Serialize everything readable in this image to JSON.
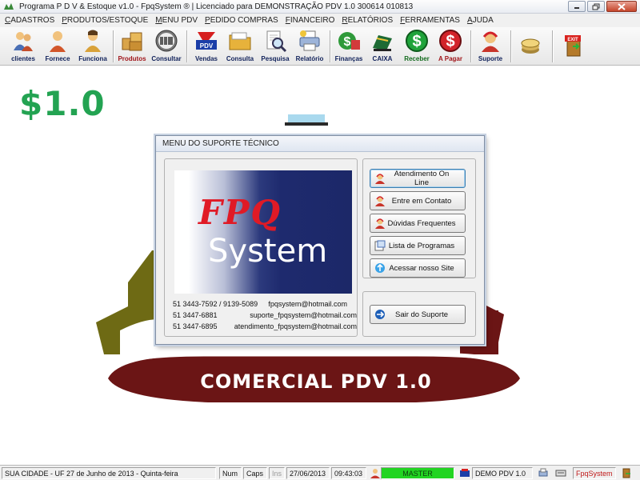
{
  "window": {
    "title": "Programa P D V & Estoque v1.0 - FpqSystem ® | Licenciado para  DEMONSTRAÇÃO PDV 1.0 300614 010813"
  },
  "menu": [
    "CADASTROS",
    "PRODUTOS/ESTOQUE",
    "MENU PDV",
    "PEDIDO COMPRAS",
    "FINANCEIRO",
    "RELATÓRIOS",
    "FERRAMENTAS",
    "AJUDA"
  ],
  "toolbar": {
    "clientes": "clientes",
    "fornece": "Fornece",
    "funciona": "Funciona",
    "produtos": "Produtos",
    "consultar": "Consultar",
    "vendas": "Vendas",
    "consulta": "Consulta",
    "pesquisa": "Pesquisa",
    "relatorio": "Relatório",
    "financas": "Finanças",
    "caixa": "CAIXA",
    "receber": "Receber",
    "apagar": "A Pagar",
    "suporte": "Suporte",
    "pdv_badge": "PDV",
    "exit_badge": "EXIT"
  },
  "desktop": {
    "version": "$1.0",
    "caption": "COMERCIAL PDV 1.0"
  },
  "dialog": {
    "title": "MENU DO SUPORTE TÉCNICO",
    "banner_brand": "FPQ",
    "banner_system": "System",
    "contacts": [
      {
        "phone": "51 3443-7592 / 9139-5089",
        "email": "fpqsystem@hotmail.com"
      },
      {
        "phone": "51 3447-6881",
        "email": "suporte_fpqsystem@hotmail.com"
      },
      {
        "phone": "51 3447-6895",
        "email": "atendimento_fpqsystem@hotmail.com"
      }
    ],
    "buttons": {
      "online": "Atendimento On Line",
      "contato": "Entre em Contato",
      "duvidas": "Dúvidas Frequentes",
      "programas": "Lista de Programas",
      "site": "Acessar nosso Site",
      "sair": "Sair do Suporte"
    }
  },
  "statusbar": {
    "location": "SUA CIDADE - UF 27 de Junho de 2013 - Quinta-feira",
    "num": "Num",
    "caps": "Caps",
    "ins": "Ins",
    "date": "27/06/2013",
    "time": "09:43:03",
    "master": "MASTER",
    "demo": "DEMO PDV 1.0",
    "brand": "FpqSystem"
  },
  "colors": {
    "version_green": "#23a352",
    "logo_red": "#6b1515",
    "logo_olive": "#6e6a14",
    "banner_navy": "#1c2868",
    "banner_red": "#e01a26",
    "master_green": "#22d422"
  }
}
